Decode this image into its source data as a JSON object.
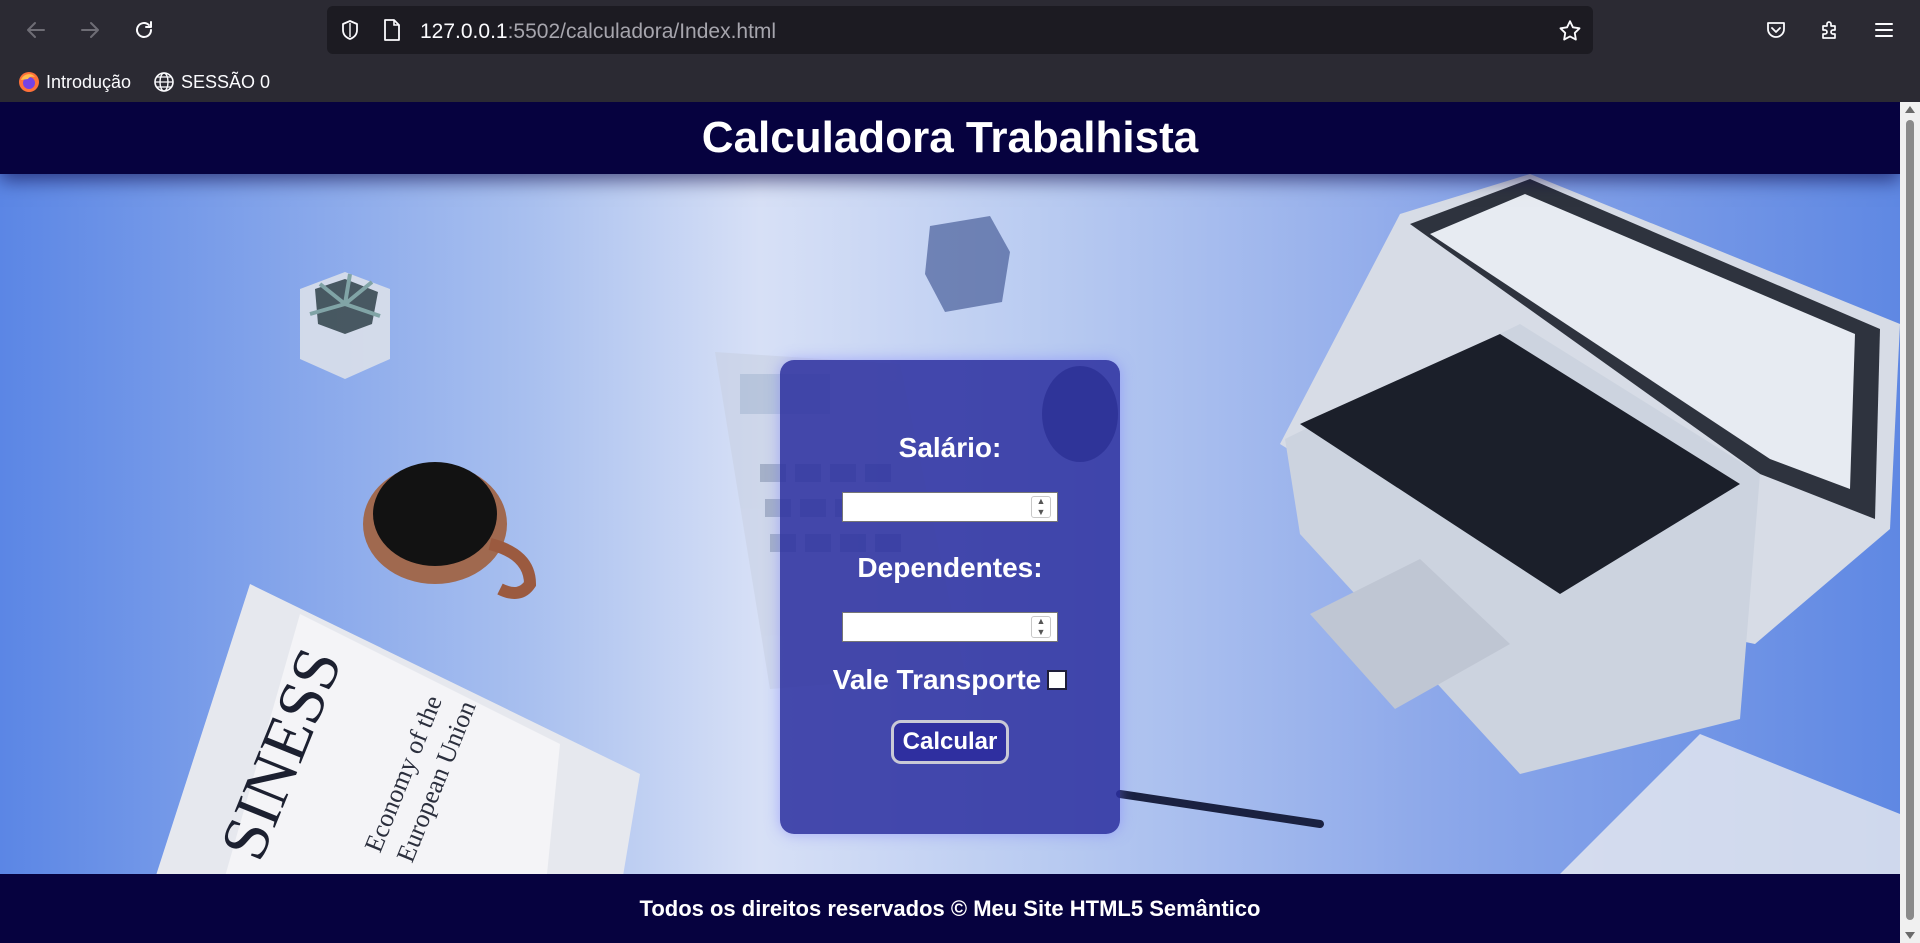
{
  "browser": {
    "url_host": "127.0.0.1",
    "url_path": ":5502/calculadora/Index.html",
    "bookmarks": [
      {
        "label": "Introdução",
        "icon": "firefox-icon"
      },
      {
        "label": "SESSÃO 0",
        "icon": "globe-icon"
      }
    ]
  },
  "page": {
    "title": "Calculadora Trabalhista",
    "form": {
      "salario_label": "Salário:",
      "salario_value": "",
      "dependentes_label": "Dependentes:",
      "dependentes_value": "",
      "vale_transporte_label": "Vale Transporte",
      "vale_transporte_checked": false,
      "calcular_label": "Calcular"
    },
    "footer_text": "Todos os direitos reservados © Meu Site HTML5 Semântico"
  },
  "colors": {
    "header_bg": "#06023f",
    "card_bg": "#2c30a0",
    "hero_blue": "#5b86e5"
  }
}
